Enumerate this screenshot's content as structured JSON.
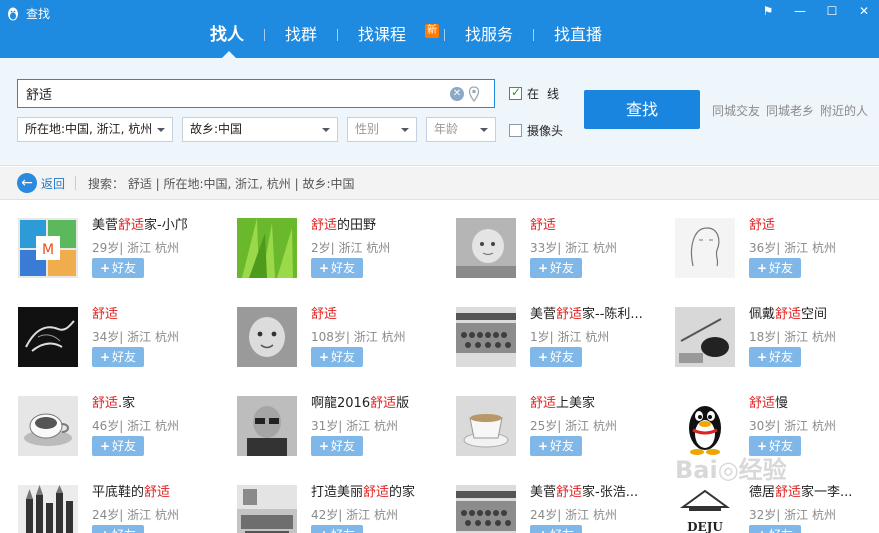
{
  "window": {
    "title": "查找",
    "controls": [
      "menu",
      "minimize",
      "maximize",
      "close"
    ]
  },
  "tabs": [
    {
      "label": "找人",
      "active": true
    },
    {
      "label": "找群",
      "active": false
    },
    {
      "label": "找课程",
      "active": false,
      "badge": "新"
    },
    {
      "label": "找服务",
      "active": false
    },
    {
      "label": "找直播",
      "active": false
    }
  ],
  "search": {
    "keyword": "舒适",
    "online_label": "在线",
    "online_checked": true,
    "camera_label": "摄像头",
    "camera_checked": false,
    "button": "查找",
    "quick_links": [
      "同城交友",
      "同城老乡",
      "附近的人"
    ],
    "filters": {
      "location": "所在地:中国, 浙江, 杭州",
      "hometown": "故乡:中国",
      "gender": "性别",
      "age": "年龄"
    }
  },
  "crumb": {
    "back": "返回",
    "text": "搜索： 舒适 | 所在地:中国, 浙江, 杭州 | 故乡:中国"
  },
  "add_label": "好友",
  "results": [
    {
      "pre": "美菅",
      "hl": "舒适",
      "post": "家-小邝",
      "meta": "29岁| 浙江 杭州",
      "avatar": "logo-tiles"
    },
    {
      "pre": "",
      "hl": "舒适",
      "post": "的田野",
      "meta": "2岁| 浙江 杭州",
      "avatar": "green-grass"
    },
    {
      "pre": "",
      "hl": "舒适",
      "post": "",
      "meta": "33岁| 浙江 杭州",
      "avatar": "baby-photo"
    },
    {
      "pre": "",
      "hl": "舒适",
      "post": "",
      "meta": "36岁| 浙江 杭州",
      "avatar": "sketch-face"
    },
    {
      "pre": "",
      "hl": "舒适",
      "post": "",
      "meta": "34岁| 浙江 杭州",
      "avatar": "smoke-horse"
    },
    {
      "pre": "",
      "hl": "舒适",
      "post": "",
      "meta": "108岁| 浙江 杭州",
      "avatar": "toddler-photo"
    },
    {
      "pre": "美菅",
      "hl": "舒适",
      "post": "家--陈利...",
      "meta": "1岁| 浙江 杭州",
      "avatar": "group-photo"
    },
    {
      "pre": "佩戴",
      "hl": "舒适",
      "post": "空间",
      "meta": "18岁| 浙江 杭州",
      "avatar": "feather-still"
    },
    {
      "pre": "",
      "hl": "舒适",
      "post": ".家",
      "meta": "46岁| 浙江 杭州",
      "avatar": "coffee-cup"
    },
    {
      "pre": "啊龍2016",
      "hl": "舒适",
      "post": "版",
      "meta": "31岁| 浙江 杭州",
      "avatar": "man-sunglasses"
    },
    {
      "pre": "",
      "hl": "舒适",
      "post": "上美家",
      "meta": "25岁| 浙江 杭州",
      "avatar": "teacup"
    },
    {
      "pre": "",
      "hl": "舒适",
      "post": "慢",
      "meta": "30岁| 浙江 杭州",
      "avatar": "qq-penguin"
    },
    {
      "pre": "平底鞋的",
      "hl": "舒适",
      "post": "",
      "meta": "24岁| 浙江 杭州",
      "avatar": "pencils"
    },
    {
      "pre": "打造美丽",
      "hl": "舒适",
      "post": "的家",
      "meta": "42岁| 浙江 杭州",
      "avatar": "living-room"
    },
    {
      "pre": "美菅",
      "hl": "舒适",
      "post": "家-张浩...",
      "meta": "24岁| 浙江 杭州",
      "avatar": "group-photo"
    },
    {
      "pre": "德居",
      "hl": "舒适",
      "post": "家一李...",
      "meta": "32岁| 浙江 杭州",
      "avatar": "deju-logo",
      "avatar_text": "DEJU"
    }
  ],
  "colors": {
    "brand": "#1e8ae0",
    "highlight": "#e02222",
    "add_button": "#7fb7e8"
  }
}
